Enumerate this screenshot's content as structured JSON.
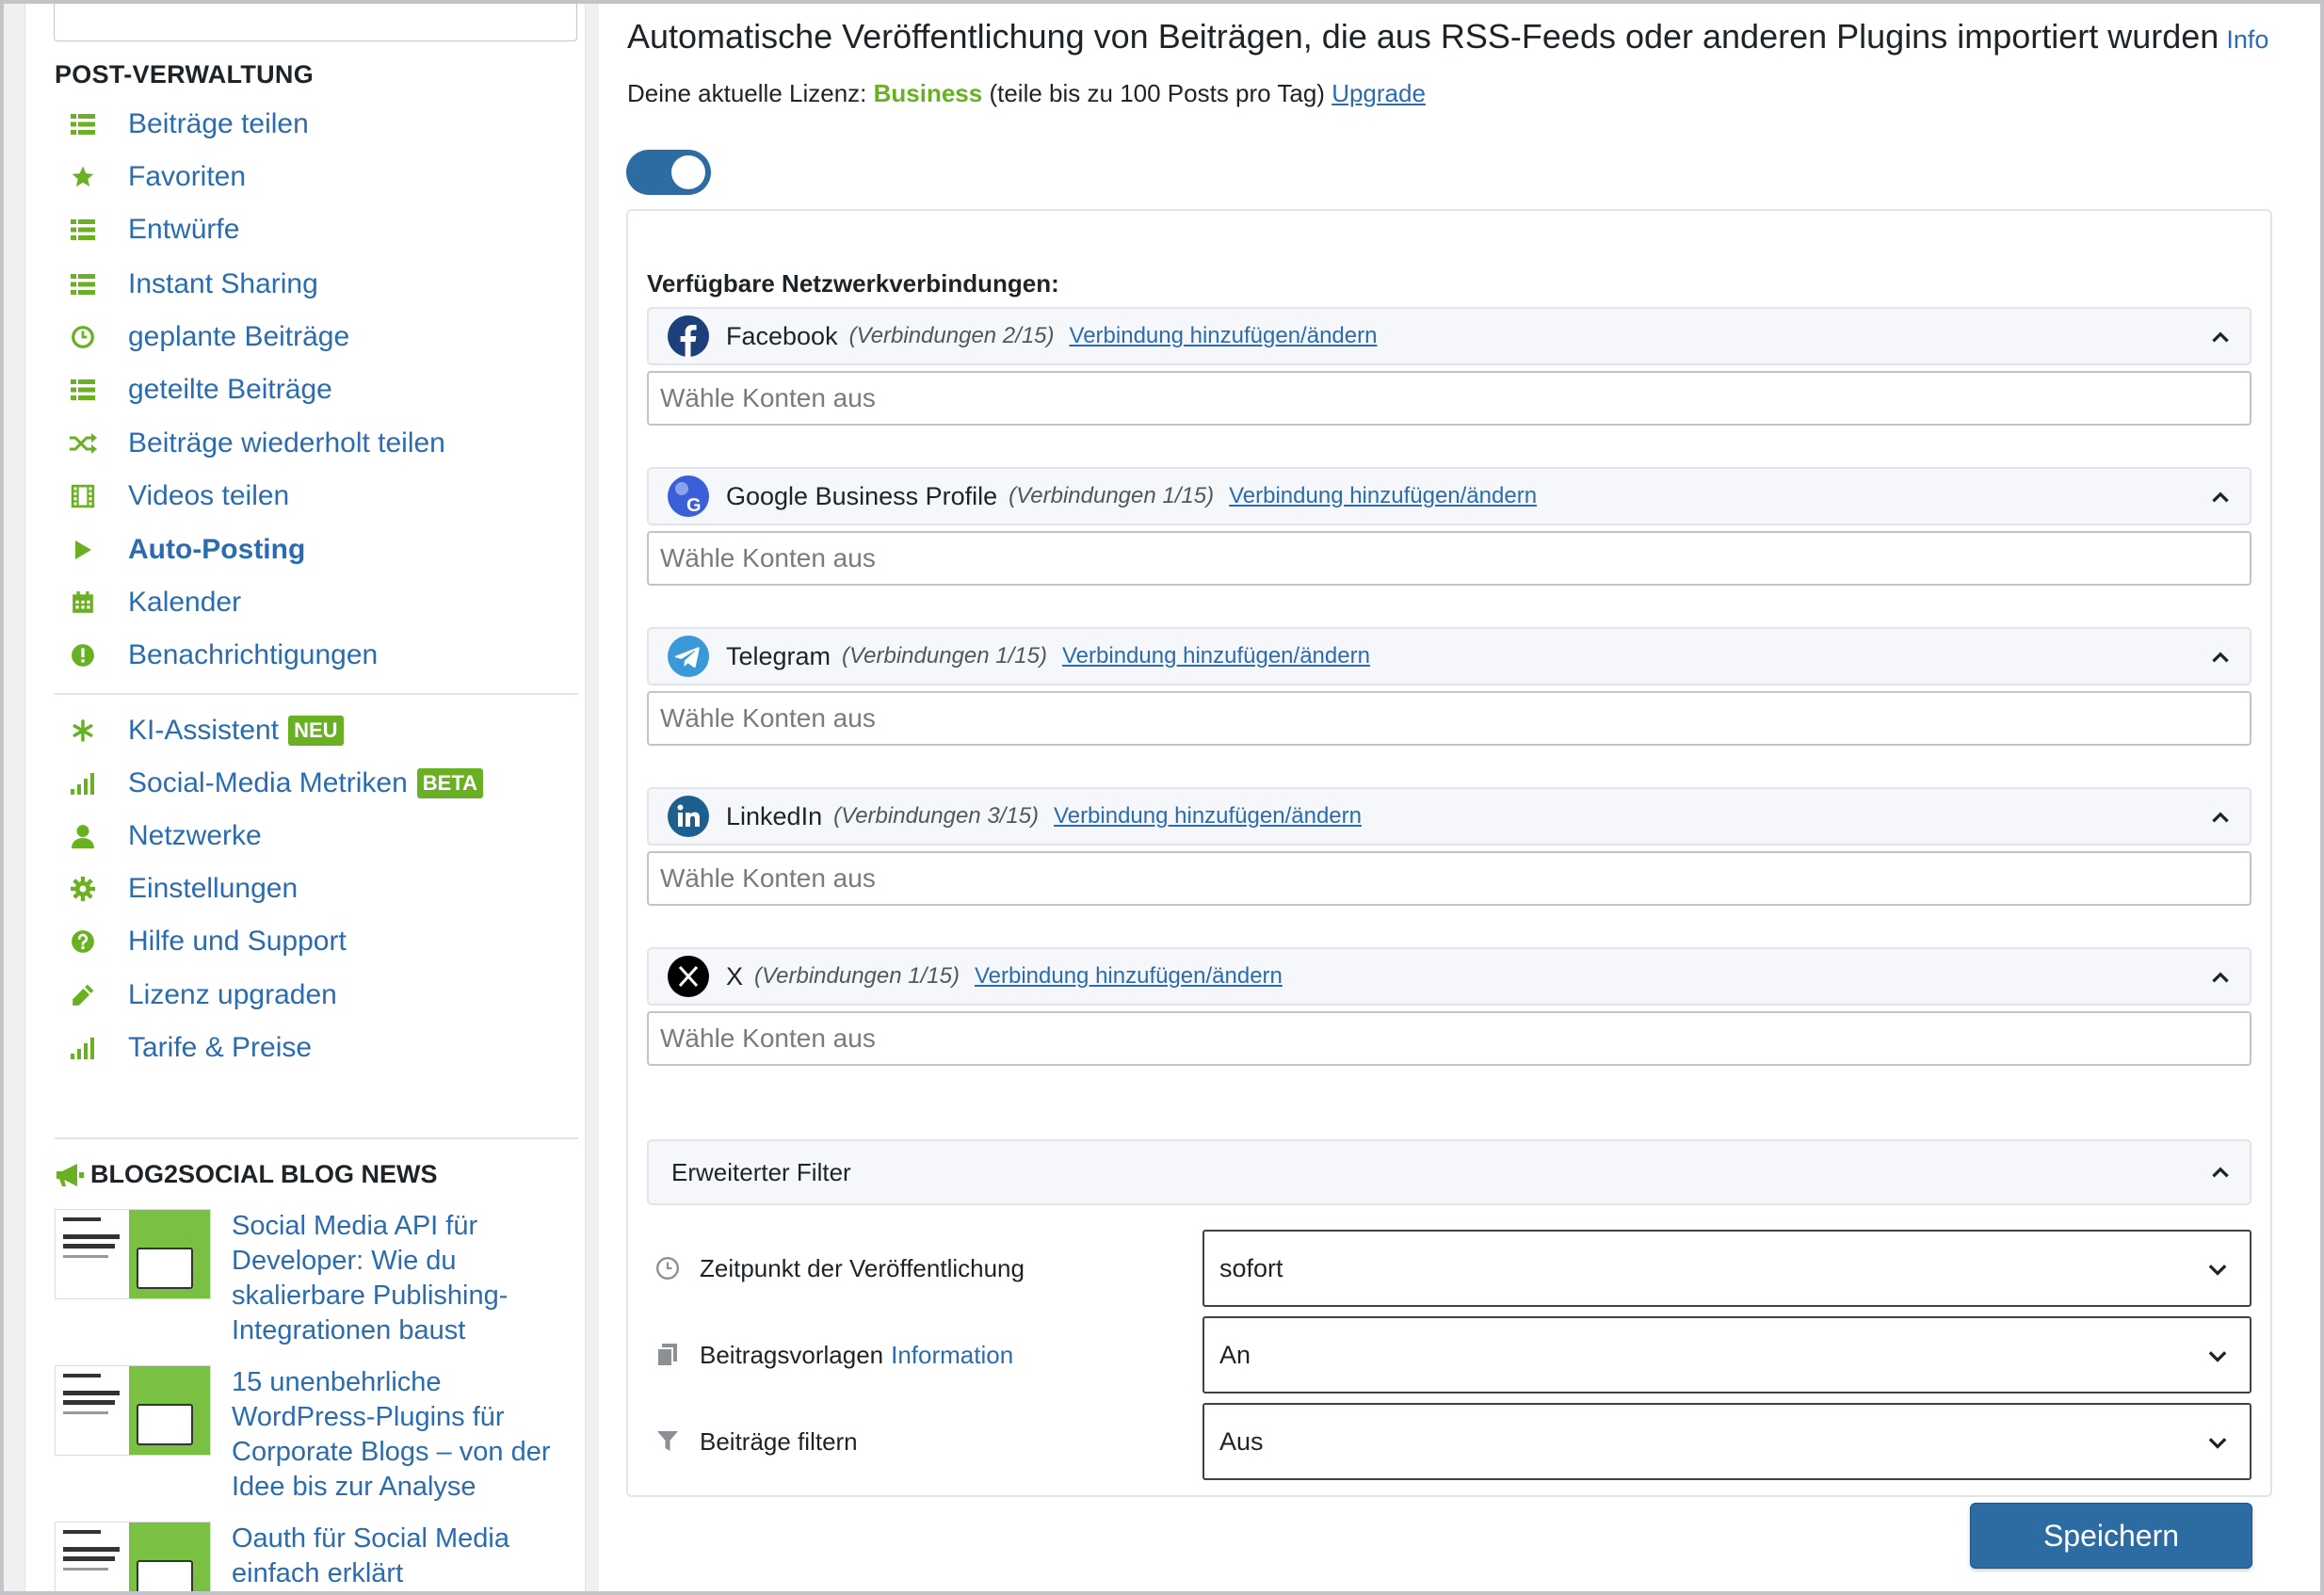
{
  "sidebar": {
    "heading": "POST-VERWALTUNG",
    "items": [
      {
        "label": "Beiträge teilen",
        "icon": "list-icon"
      },
      {
        "label": "Favoriten",
        "icon": "star-icon"
      },
      {
        "label": "Entwürfe",
        "icon": "list-icon"
      },
      {
        "label": "Instant Sharing",
        "icon": "list-icon"
      },
      {
        "label": "geplante Beiträge",
        "icon": "clock-icon"
      },
      {
        "label": "geteilte Beiträge",
        "icon": "list-icon"
      },
      {
        "label": "Beiträge wiederholt teilen",
        "icon": "shuffle-icon"
      },
      {
        "label": "Videos teilen",
        "icon": "film-icon"
      },
      {
        "label": "Auto-Posting",
        "icon": "play-icon"
      },
      {
        "label": "Kalender",
        "icon": "calendar-icon"
      },
      {
        "label": "Benachrichtigungen",
        "icon": "alert-icon"
      }
    ],
    "items2": [
      {
        "label": "KI-Assistent",
        "icon": "asterisk-icon",
        "badge": "NEU"
      },
      {
        "label": "Social-Media Metriken",
        "icon": "bar-chart-icon",
        "badge": "BETA"
      },
      {
        "label": "Netzwerke",
        "icon": "user-icon"
      },
      {
        "label": "Einstellungen",
        "icon": "gear-icon"
      },
      {
        "label": "Hilfe und Support",
        "icon": "question-icon"
      },
      {
        "label": "Lizenz upgraden",
        "icon": "pencil-icon"
      },
      {
        "label": "Tarife & Preise",
        "icon": "bar-chart-icon"
      }
    ],
    "news_heading": "BLOG2SOCIAL BLOG NEWS",
    "news": [
      {
        "title": "Social Media API für Developer: Wie du skalierbare Publishing-Integrationen baust"
      },
      {
        "title": "15 unenbehrliche WordPress-Plugins für Corporate Blogs – von der Idee bis zur Analyse"
      },
      {
        "title": "Oauth für Social Media einfach erklärt"
      }
    ]
  },
  "main": {
    "title": "Automatische Veröffentlichung von Beiträgen, die aus RSS-Feeds oder anderen Plugins importiert wurden",
    "title_info": "Info",
    "license_prefix": "Deine aktuelle Lizenz:",
    "license_plan": "Business",
    "license_suffix": "(teile bis zu 100 Posts pro Tag)",
    "upgrade_link": "Upgrade",
    "section_label": "Verfügbare Netzwerkverbindungen:",
    "networks": [
      {
        "name": "Facebook",
        "count": "(Verbindungen 2/15)",
        "link": "Verbindung hinzufügen/ändern",
        "placeholder": "Wähle Konten aus"
      },
      {
        "name": "Google Business Profile",
        "count": "(Verbindungen 1/15)",
        "link": "Verbindung hinzufügen/ändern",
        "placeholder": "Wähle Konten aus"
      },
      {
        "name": "Telegram",
        "count": "(Verbindungen 1/15)",
        "link": "Verbindung hinzufügen/ändern",
        "placeholder": "Wähle Konten aus"
      },
      {
        "name": "LinkedIn",
        "count": "(Verbindungen 3/15)",
        "link": "Verbindung hinzufügen/ändern",
        "placeholder": "Wähle Konten aus"
      },
      {
        "name": "X",
        "count": "(Verbindungen 1/15)",
        "link": "Verbindung hinzufügen/ändern",
        "placeholder": "Wähle Konten aus"
      }
    ],
    "filter_title": "Erweiterter Filter",
    "options": [
      {
        "label": "Zeitpunkt der Veröffentlichung",
        "value": "sofort",
        "info": ""
      },
      {
        "label": "Beitragsvorlagen",
        "value": "An",
        "info": "Information"
      },
      {
        "label": "Beiträge filtern",
        "value": "Aus",
        "info": ""
      }
    ],
    "save_label": "Speichern"
  },
  "colors": {
    "accent": "#2d6ca2",
    "link": "#2b6cb0",
    "green": "#6ab023",
    "icon_green": "#6ab023"
  }
}
